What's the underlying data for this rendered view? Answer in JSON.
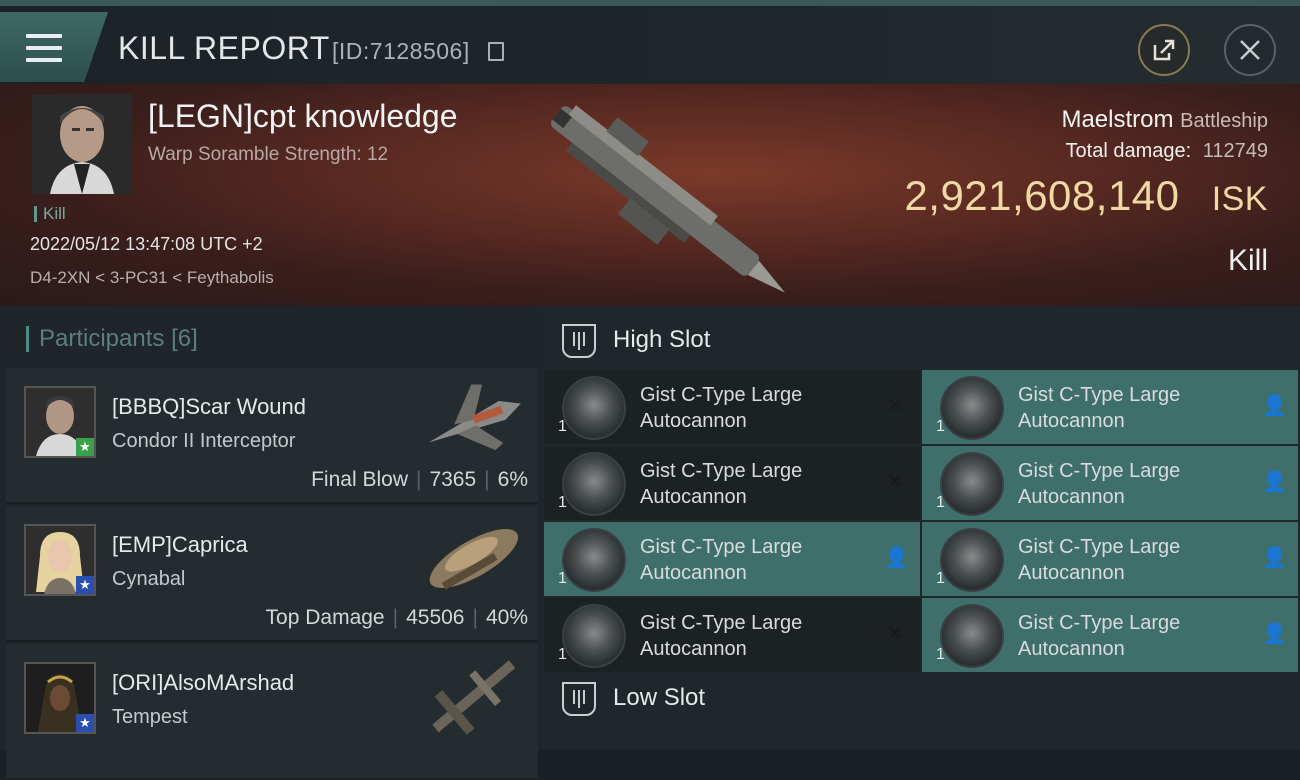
{
  "header": {
    "title": "KILL REPORT",
    "report_id": "[ID:7128506]"
  },
  "victim": {
    "name": "[LEGN]cpt knowledge",
    "scramble": "Warp Soramble Strength: 12",
    "tag": "Kill",
    "datetime": "2022/05/12 13:47:08 UTC +2",
    "location": "D4-2XN < 3-PC31 < Feythabolis",
    "ship_name": "Maelstrom",
    "ship_class": "Battleship",
    "total_damage_label": "Total damage:",
    "total_damage": "112749",
    "isk_value": "2,921,608,140",
    "isk_unit": "ISK",
    "result": "Kill"
  },
  "participants": {
    "label": "Participants",
    "count": "[6]",
    "rows": [
      {
        "name": "[BBBQ]Scar Wound",
        "ship": "Condor II Interceptor",
        "role": "Final Blow",
        "damage": "7365",
        "percent": "6%",
        "badge_color": "#3aa04a"
      },
      {
        "name": "[EMP]Caprica",
        "ship": "Cynabal",
        "role": "Top Damage",
        "damage": "45506",
        "percent": "40%",
        "badge_color": "#2b4fb0"
      },
      {
        "name": "[ORI]AlsoMArshad",
        "ship": "Tempest",
        "role": "",
        "damage": "",
        "percent": "",
        "badge_color": "#2b4fb0"
      }
    ]
  },
  "slots": {
    "high_label": "High Slot",
    "low_label": "Low Slot",
    "modules": [
      {
        "name": "Gist C-Type Large Autocannon",
        "qty": "1",
        "status": "destroyed"
      },
      {
        "name": "Gist C-Type Large Autocannon",
        "qty": "1",
        "status": "dropped"
      },
      {
        "name": "Gist C-Type Large Autocannon",
        "qty": "1",
        "status": "destroyed"
      },
      {
        "name": "Gist C-Type Large Autocannon",
        "qty": "1",
        "status": "dropped"
      },
      {
        "name": "Gist C-Type Large Autocannon",
        "qty": "1",
        "status": "dropped"
      },
      {
        "name": "Gist C-Type Large Autocannon",
        "qty": "1",
        "status": "dropped"
      },
      {
        "name": "Gist C-Type Large Autocannon",
        "qty": "1",
        "status": "destroyed"
      },
      {
        "name": "Gist C-Type Large Autocannon",
        "qty": "1",
        "status": "dropped"
      }
    ]
  },
  "colors": {
    "accent": "#3f6f6a",
    "isk_gold": "#f1d9a4"
  }
}
